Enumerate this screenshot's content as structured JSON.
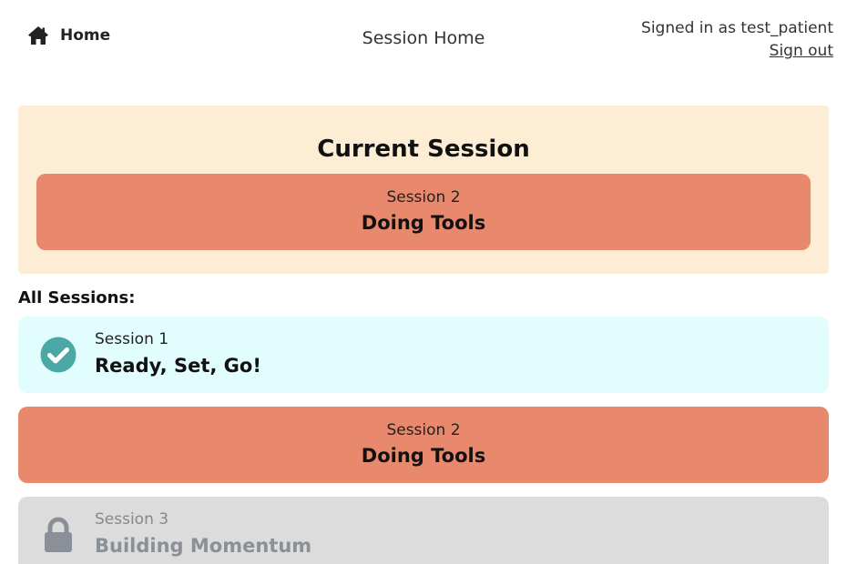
{
  "header": {
    "home_label": "Home",
    "page_title": "Session Home",
    "signed_in_text": "Signed in as test_patient",
    "sign_out_label": "Sign out"
  },
  "current_session": {
    "heading": "Current Session",
    "number": "Session 2",
    "name": "Doing Tools",
    "color": "#e8896e"
  },
  "all_sessions": {
    "heading": "All Sessions:",
    "items": [
      {
        "number": "Session 1",
        "name": "Ready, Set, Go!",
        "status": "completed",
        "icon": "check-circle-icon",
        "color": "#e2fdfd"
      },
      {
        "number": "Session 2",
        "name": "Doing Tools",
        "status": "current",
        "icon": "",
        "color": "#e8896e"
      },
      {
        "number": "Session 3",
        "name": "Building Momentum",
        "status": "locked",
        "icon": "lock-icon",
        "color": "#dcdcdc"
      }
    ]
  },
  "colors": {
    "current_panel_bg": "#fcedd4",
    "check_icon": "#4aa9a4",
    "lock_icon": "#8a8f98"
  }
}
